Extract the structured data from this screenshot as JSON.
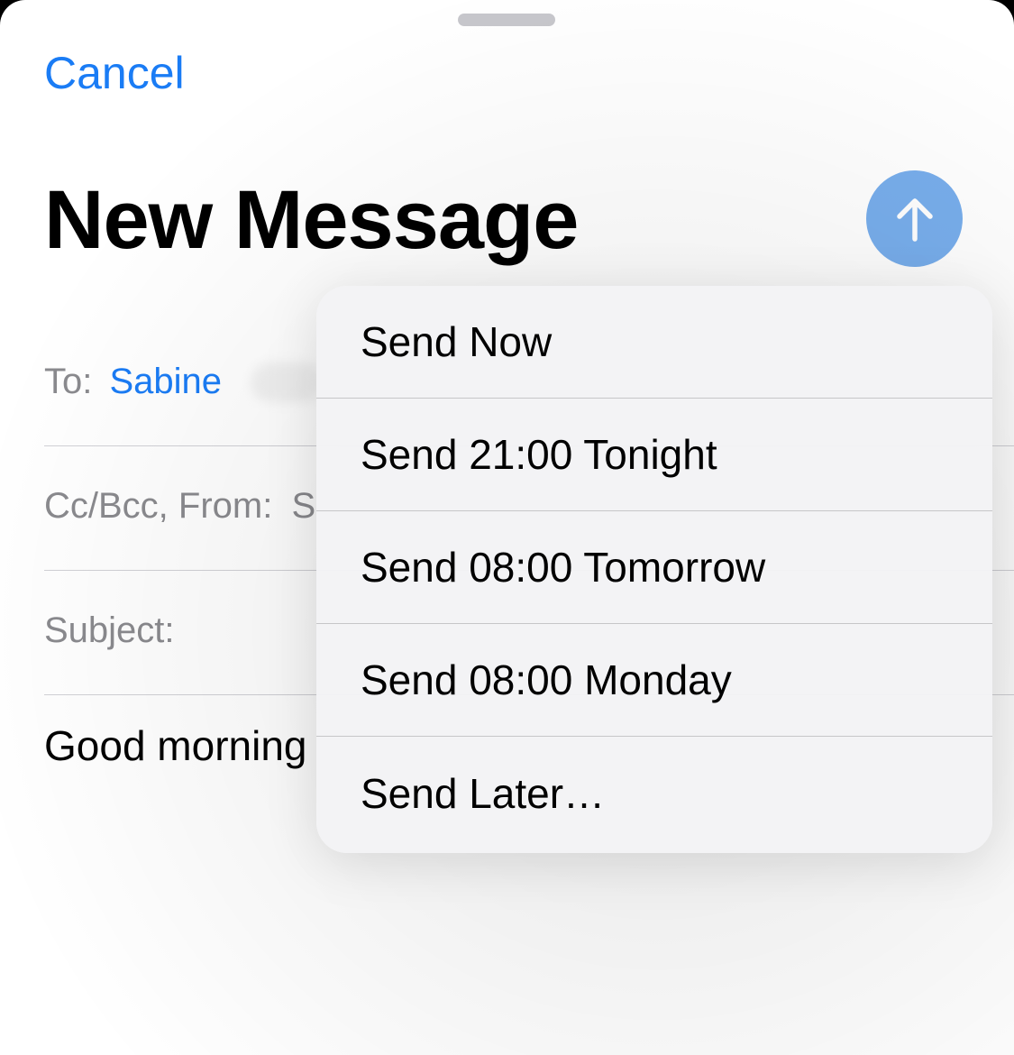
{
  "header": {
    "cancel_label": "Cancel",
    "title": "New Message"
  },
  "fields": {
    "to_label": "To:",
    "to_recipient": "Sabine",
    "cc_label": "Cc/Bcc, From:",
    "cc_value_fragment": "S",
    "subject_label": "Subject:"
  },
  "body": {
    "text": "Good morning"
  },
  "send_menu": {
    "items": [
      {
        "label": "Send Now"
      },
      {
        "label": "Send 21:00 Tonight"
      },
      {
        "label": "Send 08:00 Tomorrow"
      },
      {
        "label": "Send 08:00 Monday"
      },
      {
        "label": "Send Later…"
      }
    ]
  },
  "colors": {
    "accent": "#1a7cf5",
    "send_button": "#78aeec",
    "secondary_text": "#8a8a8e"
  },
  "icons": {
    "send": "arrow-up-icon"
  }
}
